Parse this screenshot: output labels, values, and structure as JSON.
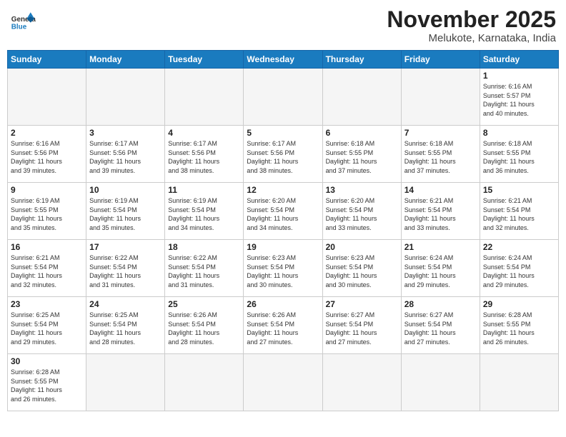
{
  "header": {
    "logo_general": "General",
    "logo_blue": "Blue",
    "month_title": "November 2025",
    "location": "Melukote, Karnataka, India"
  },
  "weekdays": [
    "Sunday",
    "Monday",
    "Tuesday",
    "Wednesday",
    "Thursday",
    "Friday",
    "Saturday"
  ],
  "weeks": [
    [
      {
        "day": "",
        "info": ""
      },
      {
        "day": "",
        "info": ""
      },
      {
        "day": "",
        "info": ""
      },
      {
        "day": "",
        "info": ""
      },
      {
        "day": "",
        "info": ""
      },
      {
        "day": "",
        "info": ""
      },
      {
        "day": "1",
        "info": "Sunrise: 6:16 AM\nSunset: 5:57 PM\nDaylight: 11 hours\nand 40 minutes."
      }
    ],
    [
      {
        "day": "2",
        "info": "Sunrise: 6:16 AM\nSunset: 5:56 PM\nDaylight: 11 hours\nand 39 minutes."
      },
      {
        "day": "3",
        "info": "Sunrise: 6:17 AM\nSunset: 5:56 PM\nDaylight: 11 hours\nand 39 minutes."
      },
      {
        "day": "4",
        "info": "Sunrise: 6:17 AM\nSunset: 5:56 PM\nDaylight: 11 hours\nand 38 minutes."
      },
      {
        "day": "5",
        "info": "Sunrise: 6:17 AM\nSunset: 5:56 PM\nDaylight: 11 hours\nand 38 minutes."
      },
      {
        "day": "6",
        "info": "Sunrise: 6:18 AM\nSunset: 5:55 PM\nDaylight: 11 hours\nand 37 minutes."
      },
      {
        "day": "7",
        "info": "Sunrise: 6:18 AM\nSunset: 5:55 PM\nDaylight: 11 hours\nand 37 minutes."
      },
      {
        "day": "8",
        "info": "Sunrise: 6:18 AM\nSunset: 5:55 PM\nDaylight: 11 hours\nand 36 minutes."
      }
    ],
    [
      {
        "day": "9",
        "info": "Sunrise: 6:19 AM\nSunset: 5:55 PM\nDaylight: 11 hours\nand 35 minutes."
      },
      {
        "day": "10",
        "info": "Sunrise: 6:19 AM\nSunset: 5:54 PM\nDaylight: 11 hours\nand 35 minutes."
      },
      {
        "day": "11",
        "info": "Sunrise: 6:19 AM\nSunset: 5:54 PM\nDaylight: 11 hours\nand 34 minutes."
      },
      {
        "day": "12",
        "info": "Sunrise: 6:20 AM\nSunset: 5:54 PM\nDaylight: 11 hours\nand 34 minutes."
      },
      {
        "day": "13",
        "info": "Sunrise: 6:20 AM\nSunset: 5:54 PM\nDaylight: 11 hours\nand 33 minutes."
      },
      {
        "day": "14",
        "info": "Sunrise: 6:21 AM\nSunset: 5:54 PM\nDaylight: 11 hours\nand 33 minutes."
      },
      {
        "day": "15",
        "info": "Sunrise: 6:21 AM\nSunset: 5:54 PM\nDaylight: 11 hours\nand 32 minutes."
      }
    ],
    [
      {
        "day": "16",
        "info": "Sunrise: 6:21 AM\nSunset: 5:54 PM\nDaylight: 11 hours\nand 32 minutes."
      },
      {
        "day": "17",
        "info": "Sunrise: 6:22 AM\nSunset: 5:54 PM\nDaylight: 11 hours\nand 31 minutes."
      },
      {
        "day": "18",
        "info": "Sunrise: 6:22 AM\nSunset: 5:54 PM\nDaylight: 11 hours\nand 31 minutes."
      },
      {
        "day": "19",
        "info": "Sunrise: 6:23 AM\nSunset: 5:54 PM\nDaylight: 11 hours\nand 30 minutes."
      },
      {
        "day": "20",
        "info": "Sunrise: 6:23 AM\nSunset: 5:54 PM\nDaylight: 11 hours\nand 30 minutes."
      },
      {
        "day": "21",
        "info": "Sunrise: 6:24 AM\nSunset: 5:54 PM\nDaylight: 11 hours\nand 29 minutes."
      },
      {
        "day": "22",
        "info": "Sunrise: 6:24 AM\nSunset: 5:54 PM\nDaylight: 11 hours\nand 29 minutes."
      }
    ],
    [
      {
        "day": "23",
        "info": "Sunrise: 6:25 AM\nSunset: 5:54 PM\nDaylight: 11 hours\nand 29 minutes."
      },
      {
        "day": "24",
        "info": "Sunrise: 6:25 AM\nSunset: 5:54 PM\nDaylight: 11 hours\nand 28 minutes."
      },
      {
        "day": "25",
        "info": "Sunrise: 6:26 AM\nSunset: 5:54 PM\nDaylight: 11 hours\nand 28 minutes."
      },
      {
        "day": "26",
        "info": "Sunrise: 6:26 AM\nSunset: 5:54 PM\nDaylight: 11 hours\nand 27 minutes."
      },
      {
        "day": "27",
        "info": "Sunrise: 6:27 AM\nSunset: 5:54 PM\nDaylight: 11 hours\nand 27 minutes."
      },
      {
        "day": "28",
        "info": "Sunrise: 6:27 AM\nSunset: 5:54 PM\nDaylight: 11 hours\nand 27 minutes."
      },
      {
        "day": "29",
        "info": "Sunrise: 6:28 AM\nSunset: 5:55 PM\nDaylight: 11 hours\nand 26 minutes."
      }
    ],
    [
      {
        "day": "30",
        "info": "Sunrise: 6:28 AM\nSunset: 5:55 PM\nDaylight: 11 hours\nand 26 minutes."
      },
      {
        "day": "",
        "info": ""
      },
      {
        "day": "",
        "info": ""
      },
      {
        "day": "",
        "info": ""
      },
      {
        "day": "",
        "info": ""
      },
      {
        "day": "",
        "info": ""
      },
      {
        "day": "",
        "info": ""
      }
    ]
  ]
}
